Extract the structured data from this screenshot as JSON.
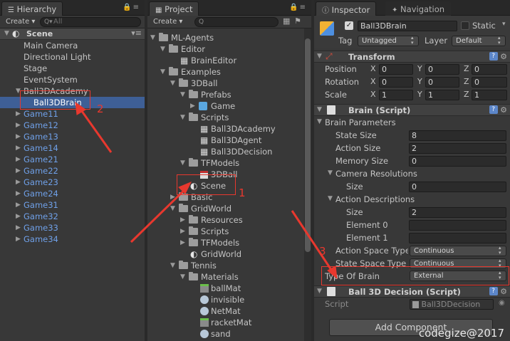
{
  "hierarchy": {
    "tab_label": "Hierarchy",
    "create_label": "Create",
    "search_placeholder": "All",
    "scene_name": "Scene",
    "items": [
      {
        "label": "Main Camera"
      },
      {
        "label": "Directional Light"
      },
      {
        "label": "Stage"
      },
      {
        "label": "EventSystem"
      },
      {
        "label": "Ball3DAcademy"
      },
      {
        "label": "Ball3DBrain"
      },
      {
        "label": "Game11"
      },
      {
        "label": "Game12"
      },
      {
        "label": "Game13"
      },
      {
        "label": "Game14"
      },
      {
        "label": "Game21"
      },
      {
        "label": "Game22"
      },
      {
        "label": "Game23"
      },
      {
        "label": "Game24"
      },
      {
        "label": "Game31"
      },
      {
        "label": "Game32"
      },
      {
        "label": "Game33"
      },
      {
        "label": "Game34"
      }
    ]
  },
  "project": {
    "tab_label": "Project",
    "create_label": "Create",
    "tree": [
      {
        "label": "ML-Agents"
      },
      {
        "label": "Editor"
      },
      {
        "label": "BrainEditor"
      },
      {
        "label": "Examples"
      },
      {
        "label": "3DBall"
      },
      {
        "label": "Prefabs"
      },
      {
        "label": "Game"
      },
      {
        "label": "Scripts"
      },
      {
        "label": "Ball3DAcademy"
      },
      {
        "label": "Ball3DAgent"
      },
      {
        "label": "Ball3DDecision"
      },
      {
        "label": "TFModels"
      },
      {
        "label": "3DBall"
      },
      {
        "label": "Scene"
      },
      {
        "label": "Basic"
      },
      {
        "label": "GridWorld"
      },
      {
        "label": "Resources"
      },
      {
        "label": "Scripts"
      },
      {
        "label": "TFModels"
      },
      {
        "label": "GridWorld"
      },
      {
        "label": "Tennis"
      },
      {
        "label": "Materials"
      },
      {
        "label": "ballMat"
      },
      {
        "label": "invisible"
      },
      {
        "label": "NetMat"
      },
      {
        "label": "racketMat"
      },
      {
        "label": "sand"
      }
    ]
  },
  "inspector": {
    "tab_label": "Inspector",
    "nav_tab_label": "Navigation",
    "object_name": "Ball3DBrain",
    "static_label": "Static",
    "tag_label": "Tag",
    "tag_value": "Untagged",
    "layer_label": "Layer",
    "layer_value": "Default",
    "transform": {
      "title": "Transform",
      "position_label": "Position",
      "rotation_label": "Rotation",
      "scale_label": "Scale",
      "x_label": "X",
      "y_label": "Y",
      "z_label": "Z",
      "position": [
        "0",
        "0",
        "0"
      ],
      "rotation": [
        "0",
        "0",
        "0"
      ],
      "scale": [
        "1",
        "1",
        "1"
      ]
    },
    "brain": {
      "title": "Brain (Script)",
      "params_label": "Brain Parameters",
      "state_size_label": "State Size",
      "state_size": "8",
      "action_size_label": "Action Size",
      "action_size": "2",
      "memory_size_label": "Memory Size",
      "memory_size": "0",
      "camera_res_label": "Camera Resolutions",
      "size_label": "Size",
      "camera_size": "0",
      "action_desc_label": "Action Descriptions",
      "action_desc_size": "2",
      "element0_label": "Element 0",
      "element0": "",
      "element1_label": "Element 1",
      "element1": "",
      "action_space_label": "Action Space Type",
      "action_space": "Continuous",
      "state_space_label": "State Space Type",
      "state_space": "Continuous",
      "brain_type_label": "Type Of Brain",
      "brain_type": "External"
    },
    "decision": {
      "title": "Ball 3D Decision (Script)",
      "script_label": "Script",
      "script_value": "Ball3DDecision"
    },
    "add_component_label": "Add Component"
  },
  "annotations": {
    "num1": "1",
    "num2": "2",
    "num3": "3",
    "color": "#e8382e"
  },
  "watermark": "codegize@2017"
}
